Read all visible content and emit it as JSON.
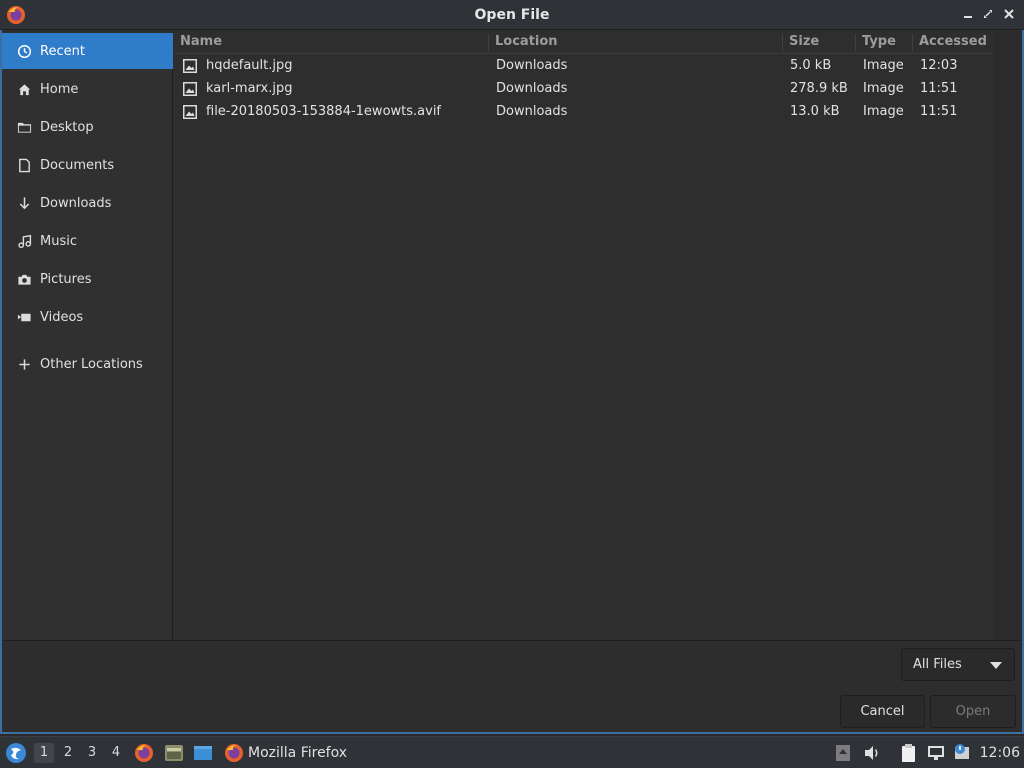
{
  "window": {
    "title": "Open File"
  },
  "sidebar": {
    "items": [
      {
        "label": "Recent",
        "icon": "clock-icon"
      },
      {
        "label": "Home",
        "icon": "home-icon"
      },
      {
        "label": "Desktop",
        "icon": "folder-icon"
      },
      {
        "label": "Documents",
        "icon": "document-icon"
      },
      {
        "label": "Downloads",
        "icon": "download-icon"
      },
      {
        "label": "Music",
        "icon": "music-icon"
      },
      {
        "label": "Pictures",
        "icon": "camera-icon"
      },
      {
        "label": "Videos",
        "icon": "video-icon"
      },
      {
        "label": "Other Locations",
        "icon": "plus-icon"
      }
    ]
  },
  "file_list": {
    "columns": [
      "Name",
      "Location",
      "Size",
      "Type",
      "Accessed"
    ],
    "rows": [
      {
        "name": "hqdefault.jpg",
        "location": "Downloads",
        "size": "5.0 kB",
        "type": "Image",
        "accessed": "12:03"
      },
      {
        "name": "karl-marx.jpg",
        "location": "Downloads",
        "size": "278.9 kB",
        "type": "Image",
        "accessed": "11:51"
      },
      {
        "name": "file-20180503-153884-1ewowts.avif",
        "location": "Downloads",
        "size": "13.0 kB",
        "type": "Image",
        "accessed": "11:51"
      }
    ]
  },
  "filter": {
    "selected": "All Files"
  },
  "buttons": {
    "cancel": "Cancel",
    "open": "Open"
  },
  "taskbar": {
    "workspaces": [
      "1",
      "2",
      "3",
      "4"
    ],
    "active_workspace": "1",
    "task_label": "Mozilla Firefox",
    "clock": "12:06"
  },
  "colors": {
    "accent": "#2f7cc8",
    "window_border": "#3b6ea5"
  }
}
